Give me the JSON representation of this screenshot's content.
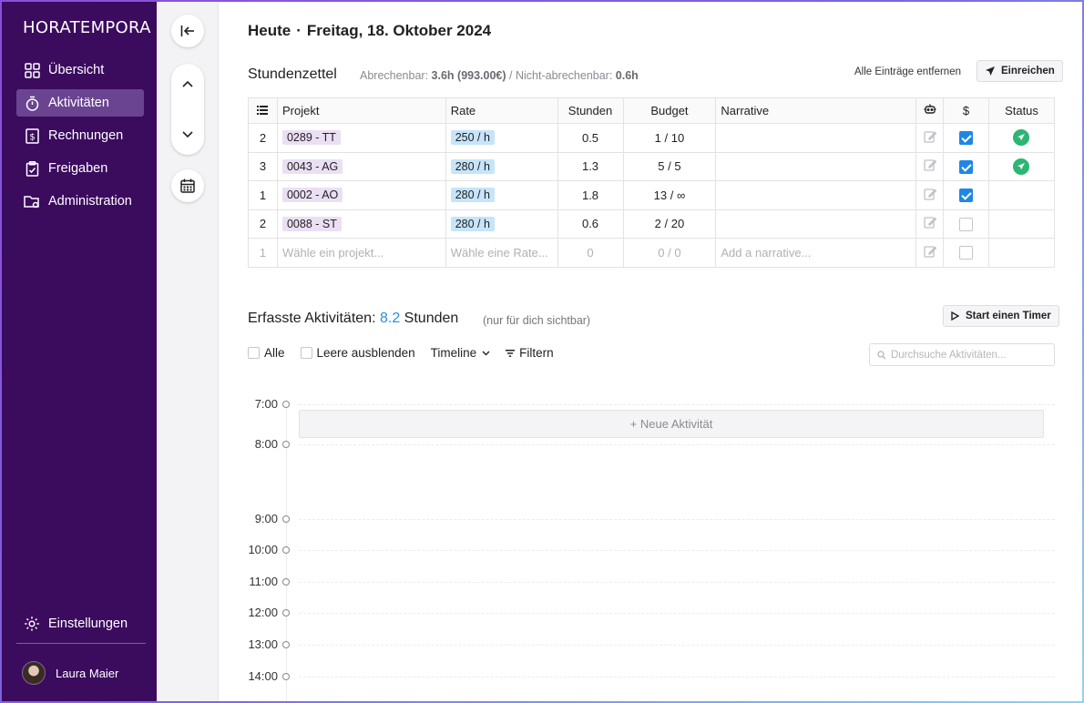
{
  "sidebar": {
    "brand": "HORATEMPORA",
    "items": [
      {
        "label": "Übersicht",
        "icon": "grid-icon",
        "active": false
      },
      {
        "label": "Aktivitäten",
        "icon": "stopwatch-icon",
        "active": true
      },
      {
        "label": "Rechnungen",
        "icon": "invoice-icon",
        "active": false
      },
      {
        "label": "Freigaben",
        "icon": "clipboard-check-icon",
        "active": false
      },
      {
        "label": "Administration",
        "icon": "folder-settings-icon",
        "active": false
      }
    ],
    "settings_label": "Einstellungen",
    "user_name": "Laura Maier"
  },
  "header": {
    "today": "Heute",
    "date": "Freitag, 18. Oktober 2024"
  },
  "stundenzettel": {
    "title": "Stundenzettel",
    "billable_label": "Abrechenbar:",
    "billable_value": "3.6h (993.00€)",
    "separator": "/",
    "nonbillable_label": "Nicht-abrechenbar:",
    "nonbillable_value": "0.6h",
    "remove_all_label": "Alle Einträge entfernen",
    "submit_label": "Einreichen",
    "columns": {
      "projekt": "Projekt",
      "rate": "Rate",
      "stunden": "Stunden",
      "budget": "Budget",
      "narrative": "Narrative",
      "billable": "$",
      "status": "Status"
    },
    "rows": [
      {
        "n": "2",
        "projekt": "0289 - TT",
        "rate": "250 / h",
        "stunden": "0.5",
        "budget": "1 / 10",
        "billable": true,
        "submitted": true
      },
      {
        "n": "3",
        "projekt": "0043 - AG",
        "rate": "280 / h",
        "stunden": "1.3",
        "budget": "5 / 5",
        "billable": true,
        "submitted": true
      },
      {
        "n": "1",
        "projekt": "0002 - AO",
        "rate": "280 / h",
        "stunden": "1.8",
        "budget": "13 / ∞",
        "billable": true,
        "submitted": false
      },
      {
        "n": "2",
        "projekt": "0088 - ST",
        "rate": "280 / h",
        "stunden": "0.6",
        "budget": "2 / 20",
        "billable": false,
        "submitted": false
      }
    ],
    "new_row": {
      "n": "1",
      "projekt_placeholder": "Wähle ein projekt...",
      "rate_placeholder": "Wähle eine Rate...",
      "stunden": "0",
      "budget": "0 / 0",
      "narrative_placeholder": "Add a narrative..."
    }
  },
  "activities": {
    "title": "Erfasste Aktivitäten:",
    "hours_value": "8.2",
    "hours_unit": "Stunden",
    "note": "(nur für dich sichtbar)",
    "timer_label": "Start einen Timer",
    "filters": {
      "all_label": "Alle",
      "hide_empty_label": "Leere ausblenden",
      "view_label": "Timeline",
      "filter_label": "Filtern"
    },
    "search_placeholder": "Durchsuche Aktivitäten...",
    "new_activity_label": "+ Neue Aktivität",
    "hours": [
      "7:00",
      "8:00",
      "9:00",
      "10:00",
      "11:00",
      "12:00",
      "13:00",
      "14:00"
    ]
  },
  "colors": {
    "sidebar_bg": "#3b0b5e",
    "accent_blue": "#1f87e5",
    "status_green": "#2bb673",
    "project_tag": "#ebdff4",
    "rate_tag": "#c6e4fa"
  }
}
